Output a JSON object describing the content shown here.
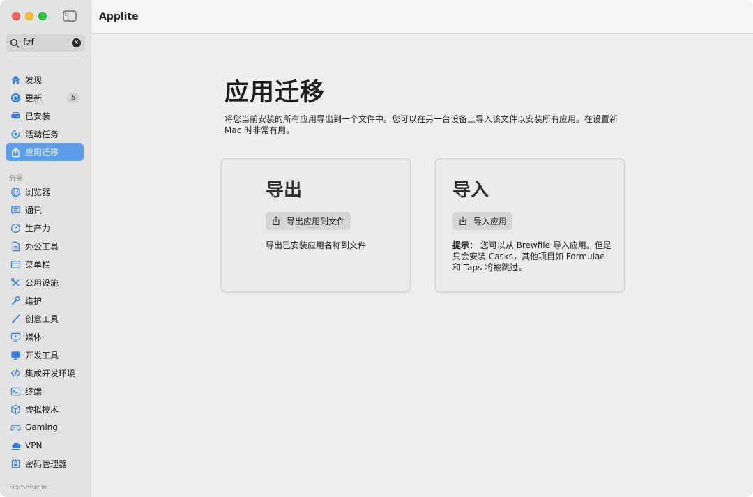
{
  "app": {
    "title": "Applite"
  },
  "search": {
    "value": "fzf",
    "clear_label": "×"
  },
  "sidebar": {
    "main_items": [
      {
        "label": "发现",
        "icon": "house-icon"
      },
      {
        "label": "更新",
        "icon": "update-icon",
        "badge": "5"
      },
      {
        "label": "已安装",
        "icon": "drive-icon"
      },
      {
        "label": "活动任务",
        "icon": "activity-icon"
      },
      {
        "label": "应用迁移",
        "icon": "migration-icon",
        "active": true
      }
    ],
    "category_label": "分类",
    "categories": [
      {
        "label": "浏览器",
        "icon": "globe-icon"
      },
      {
        "label": "通讯",
        "icon": "chat-icon"
      },
      {
        "label": "生产力",
        "icon": "gauge-icon"
      },
      {
        "label": "办公工具",
        "icon": "document-icon"
      },
      {
        "label": "菜单栏",
        "icon": "menubar-icon"
      },
      {
        "label": "公用设施",
        "icon": "tools-icon"
      },
      {
        "label": "维护",
        "icon": "wrench-icon"
      },
      {
        "label": "创意工具",
        "icon": "brush-icon"
      },
      {
        "label": "媒体",
        "icon": "media-icon"
      },
      {
        "label": "开发工具",
        "icon": "monitor-icon"
      },
      {
        "label": "集成开发环境",
        "icon": "code-icon"
      },
      {
        "label": "终端",
        "icon": "terminal-icon"
      },
      {
        "label": "虚拟技术",
        "icon": "cube-icon"
      },
      {
        "label": "Gaming",
        "icon": "gamepad-icon"
      },
      {
        "label": "VPN",
        "icon": "vpn-icon"
      },
      {
        "label": "密码管理器",
        "icon": "lock-icon"
      }
    ],
    "footer_label": "Homebrew"
  },
  "main": {
    "title": "应用迁移",
    "description": "将您当前安装的所有应用导出到一个文件中。您可以在另一台设备上导入该文件以安装所有应用。在设置新 Mac 时非常有用。",
    "export_card": {
      "title": "导出",
      "button_label": "导出应用到文件",
      "note": "导出已安装应用名称到文件"
    },
    "import_card": {
      "title": "导入",
      "button_label": "导入应用",
      "note_prefix": "提示：",
      "note": " 您可以从 Brewfile 导入应用。但是只会安装 Casks，其他项目如 Formulae 和 Taps 将被跳过。"
    }
  },
  "colors": {
    "accent": "#5e9ee8",
    "icon_blue": "#2f7ce0"
  }
}
